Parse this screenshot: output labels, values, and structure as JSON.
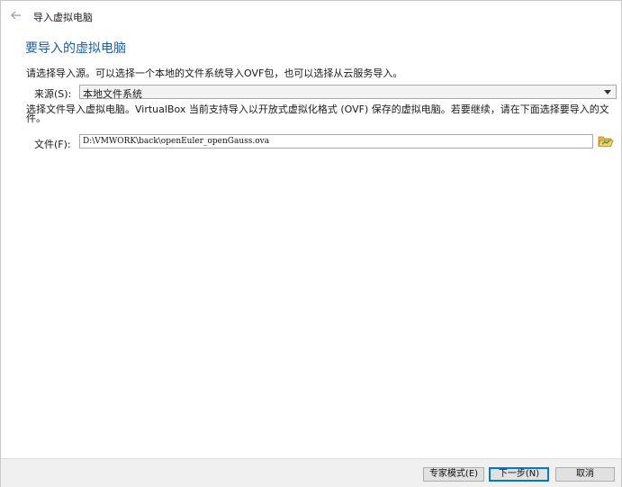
{
  "window": {
    "title": "导入虚拟电脑"
  },
  "page": {
    "heading": "要导入的虚拟电脑",
    "description": "请选择导入源。可以选择一个本地的文件系统导入OVF包，也可以选择从云服务导入。"
  },
  "source": {
    "label": "来源(S):",
    "selected": "本地文件系统"
  },
  "info_text": "选择文件导入虚拟电脑。VirtualBox 当前支持导入以开放式虚拟化格式 (OVF) 保存的虚拟电脑。若要继续，请在下面选择要导入的文件。",
  "file": {
    "label": "文件(F):",
    "value": "D:\\VMWORK\\back\\openEuler_openGauss.ova"
  },
  "buttons": {
    "expert": "专家模式(E)",
    "next": "下一步(N)",
    "cancel": "取消"
  },
  "colors": {
    "heading": "#1f5fa6",
    "primary_border": "#0078d7",
    "footer_bg": "#f0f0f0"
  },
  "icons": {
    "back": "back-arrow-icon",
    "dropdown": "chevron-down-icon",
    "folder": "folder-open-icon"
  }
}
